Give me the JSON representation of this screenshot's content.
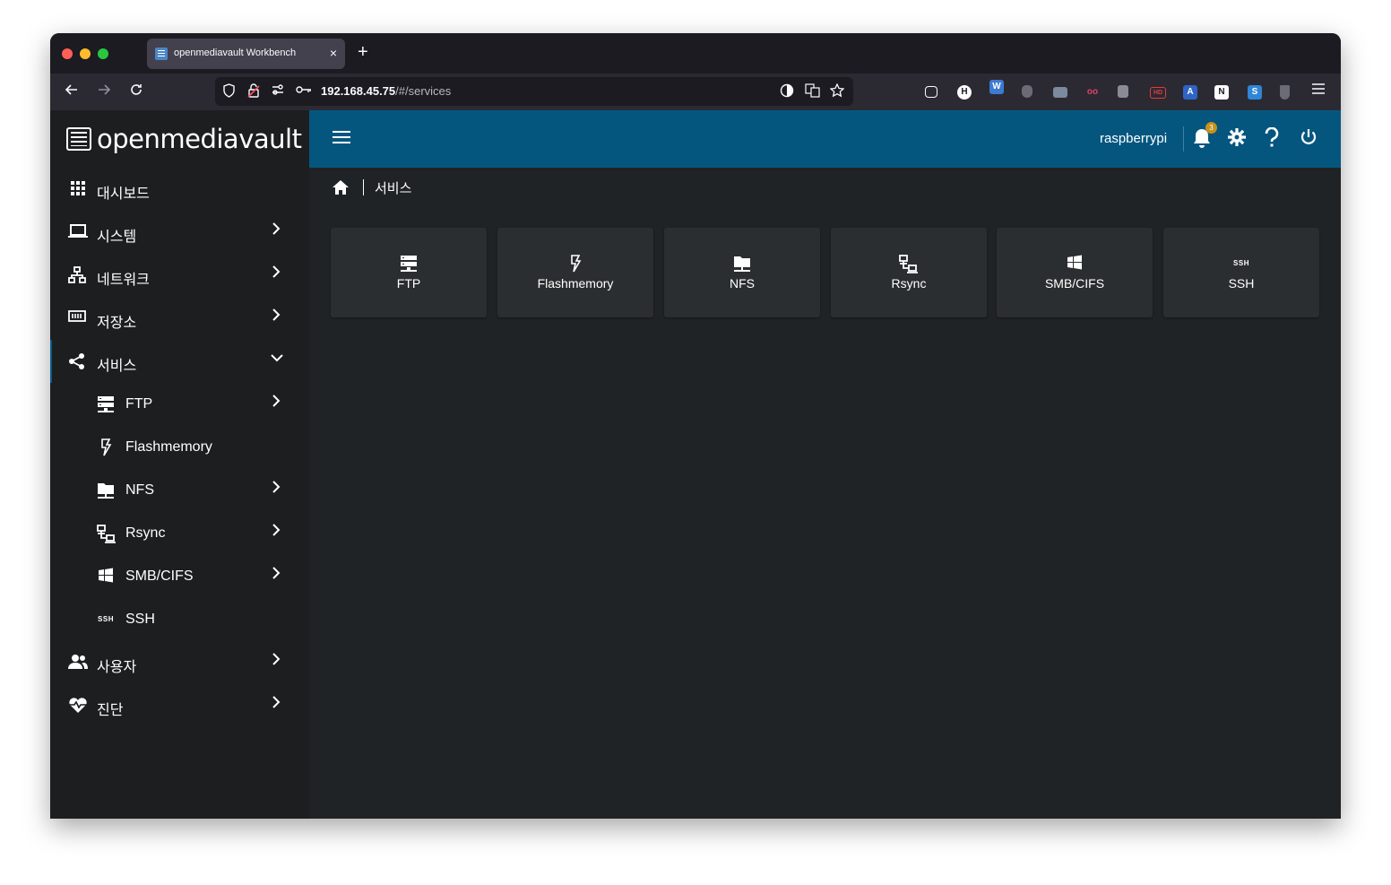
{
  "browser": {
    "tab_title": "openmediavault Workbench",
    "tab_close": "×",
    "new_tab": "+",
    "url_host": "192.168.45.75",
    "url_path": "/#/services"
  },
  "app": {
    "logo_text": "openmediavault",
    "hostname": "raspberrypi",
    "notification_count": "3",
    "breadcrumb": "서비스"
  },
  "sidebar": {
    "items": [
      {
        "label": "대시보드",
        "icon": "apps-icon"
      },
      {
        "label": "시스템",
        "icon": "laptop-icon"
      },
      {
        "label": "네트워크",
        "icon": "network-icon"
      },
      {
        "label": "저장소",
        "icon": "storage-icon"
      },
      {
        "label": "서비스",
        "icon": "share-icon"
      },
      {
        "label": "FTP",
        "icon": "server-icon"
      },
      {
        "label": "Flashmemory",
        "icon": "flash-icon"
      },
      {
        "label": "NFS",
        "icon": "folder-network-icon"
      },
      {
        "label": "Rsync",
        "icon": "lan-icon"
      },
      {
        "label": "SMB/CIFS",
        "icon": "windows-icon"
      },
      {
        "label": "SSH",
        "icon": "ssh-icon"
      },
      {
        "label": "사용자",
        "icon": "users-icon"
      },
      {
        "label": "진단",
        "icon": "heart-pulse-icon"
      }
    ]
  },
  "tiles": [
    {
      "label": "FTP"
    },
    {
      "label": "Flashmemory"
    },
    {
      "label": "NFS"
    },
    {
      "label": "Rsync"
    },
    {
      "label": "SMB/CIFS"
    },
    {
      "label": "SSH",
      "icon_text": "SSH"
    }
  ],
  "colors": {
    "topbar": "#05567f",
    "sidebar_bg": "#1c1e20",
    "content_bg": "#202325",
    "tile_bg": "#2b2e30",
    "badge": "#c7921c"
  }
}
